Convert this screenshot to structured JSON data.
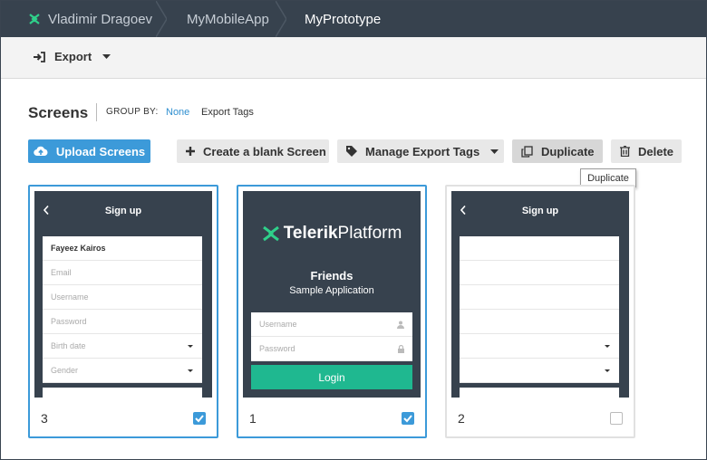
{
  "breadcrumb": {
    "user": "Vladimir Dragoev",
    "app": "MyMobileApp",
    "prototype": "MyPrototype"
  },
  "toolbar": {
    "export_label": "Export"
  },
  "screens": {
    "title": "Screens",
    "group_by_label": "GROUP BY:",
    "group_options": [
      "None",
      "Export Tags"
    ],
    "selected_group": "None"
  },
  "actions": {
    "upload": "Upload Screens",
    "create_blank": "Create a blank Screen",
    "manage_tags": "Manage Export Tags",
    "duplicate": "Duplicate",
    "delete": "Delete"
  },
  "tooltip": {
    "text": "Duplicate"
  },
  "cards": [
    {
      "number": "3",
      "checked": true,
      "nav_title": "Sign up",
      "fields": [
        {
          "text": "Fayeez Kairos",
          "filled": true,
          "dropdown": false
        },
        {
          "text": "Email",
          "filled": false,
          "dropdown": false
        },
        {
          "text": "Username",
          "filled": false,
          "dropdown": false
        },
        {
          "text": "Password",
          "filled": false,
          "dropdown": false
        },
        {
          "text": "Birth date",
          "filled": false,
          "dropdown": true
        },
        {
          "text": "Gender",
          "filled": false,
          "dropdown": true
        }
      ]
    },
    {
      "number": "1",
      "checked": true,
      "logo_bold": "Telerik",
      "logo_light": "Platform",
      "heading": "Friends",
      "subheading": "Sample Application",
      "username_placeholder": "Username",
      "password_placeholder": "Password",
      "login_label": "Login"
    },
    {
      "number": "2",
      "checked": false,
      "nav_title": "Sign up",
      "fields": [
        {
          "text": "",
          "filled": false,
          "dropdown": false
        },
        {
          "text": "",
          "filled": false,
          "dropdown": false
        },
        {
          "text": "",
          "filled": false,
          "dropdown": false
        },
        {
          "text": "",
          "filled": false,
          "dropdown": false
        },
        {
          "text": "",
          "filled": false,
          "dropdown": true
        },
        {
          "text": "",
          "filled": false,
          "dropdown": true
        }
      ]
    }
  ],
  "colors": {
    "topbar": "#37424e",
    "accent": "#3c9ad9",
    "logo_green": "#2fd08a",
    "login_green": "#1fb890"
  }
}
